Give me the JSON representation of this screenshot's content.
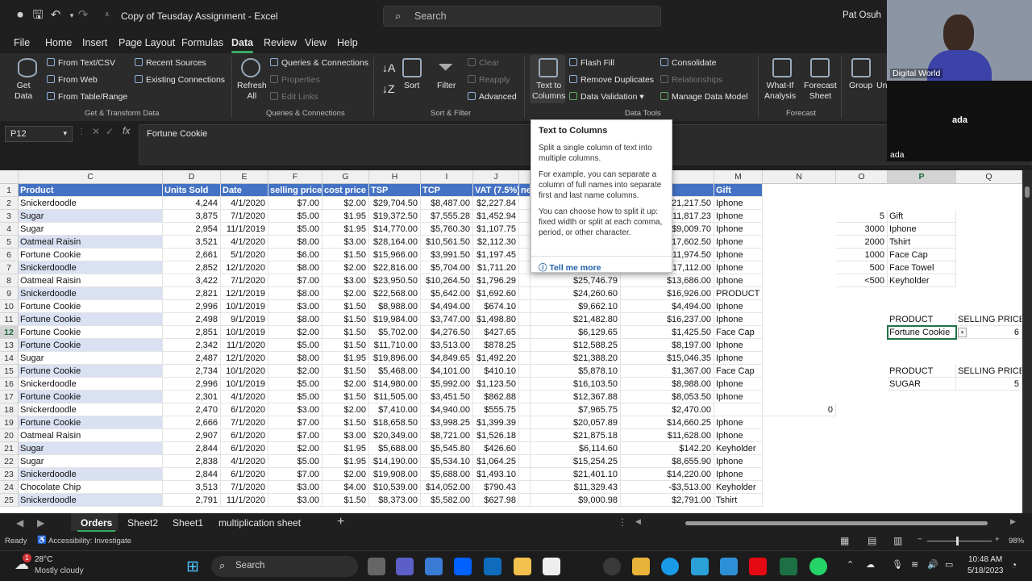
{
  "titlebar": {
    "doc_title": "Copy of Teusday Assignment  -  Excel",
    "search_placeholder": "Search",
    "user_name": "Pat Osuh"
  },
  "menu": {
    "tabs": [
      "File",
      "Home",
      "Insert",
      "Page Layout",
      "Formulas",
      "Data",
      "Review",
      "View",
      "Help"
    ],
    "active": "Data"
  },
  "ribbon": {
    "get_data": "Get\nData",
    "from_text_csv": "From Text/CSV",
    "from_web": "From Web",
    "from_table_range": "From Table/Range",
    "recent_sources": "Recent Sources",
    "existing_connections": "Existing Connections",
    "group_get_transform": "Get & Transform Data",
    "refresh_all": "Refresh\nAll",
    "queries_connections": "Queries & Connections",
    "properties": "Properties",
    "edit_links": "Edit Links",
    "group_queries": "Queries & Connections",
    "sort": "Sort",
    "filter": "Filter",
    "clear": "Clear",
    "reapply": "Reapply",
    "advanced": "Advanced",
    "group_sort_filter": "Sort & Filter",
    "text_to_columns": "Text to\nColumns",
    "flash_fill": "Flash Fill",
    "remove_duplicates": "Remove Duplicates",
    "data_validation": "Data Validation",
    "consolidate": "Consolidate",
    "relationships": "Relationships",
    "manage_data_model": "Manage Data Model",
    "group_data_tools": "Data Tools",
    "what_if": "What-If\nAnalysis",
    "forecast_sheet": "Forecast\nSheet",
    "group_forecast": "Forecast",
    "group_btn": "Group",
    "ungroup_btn": "Un"
  },
  "formula_bar": {
    "name_box": "P12",
    "fx": "fx",
    "value": "Fortune Cookie"
  },
  "columns": [
    "C",
    "D",
    "E",
    "F",
    "G",
    "H",
    "I",
    "J",
    "",
    "",
    "L",
    "M",
    "N",
    "O",
    "P",
    "Q"
  ],
  "table_headers": [
    "Product",
    "Units Sold",
    "Date",
    "selling price",
    "cost price",
    "TSP",
    "TCP",
    "VAT (7.5%)",
    "ne",
    "",
    "",
    "Gift"
  ],
  "rows": [
    [
      "Snickerdoodle",
      "4,244",
      "4/1/2020",
      "$7.00",
      "$2.00",
      "$29,704.50",
      "$8,487.00",
      "$2,227.84",
      "",
      "",
      "$21,217.50",
      "Iphone"
    ],
    [
      "Sugar",
      "3,875",
      "7/1/2020",
      "$5.00",
      "$1.95",
      "$19,372.50",
      "$7,555.28",
      "$1,452.94",
      "",
      "",
      "$11,817.23",
      "Iphone"
    ],
    [
      "Sugar",
      "2,954",
      "11/1/2019",
      "$5.00",
      "$1.95",
      "$14,770.00",
      "$5,760.30",
      "$1,107.75",
      "",
      "",
      "$9,009.70",
      "Iphone"
    ],
    [
      "Oatmeal Raisin",
      "3,521",
      "4/1/2020",
      "$8.00",
      "$3.00",
      "$28,164.00",
      "$10,561.50",
      "$2,112.30",
      "",
      "",
      "$17,602.50",
      "Iphone"
    ],
    [
      "Fortune Cookie",
      "2,661",
      "5/1/2020",
      "$6.00",
      "$1.50",
      "$15,966.00",
      "$3,991.50",
      "$1,197.45",
      "",
      "",
      "$11,974.50",
      "Iphone"
    ],
    [
      "Snickerdoodle",
      "2,852",
      "12/1/2020",
      "$8.00",
      "$2.00",
      "$22,816.00",
      "$5,704.00",
      "$1,711.20",
      "",
      "",
      "$17,112.00",
      "Iphone"
    ],
    [
      "Oatmeal Raisin",
      "3,422",
      "7/1/2020",
      "$7.00",
      "$3.00",
      "$23,950.50",
      "$10,264.50",
      "$1,796.29",
      "",
      "$25,746.79",
      "$13,686.00",
      "Iphone"
    ],
    [
      "Snickerdoodle",
      "2,821",
      "12/1/2019",
      "$8.00",
      "$2.00",
      "$22,568.00",
      "$5,642.00",
      "$1,692.60",
      "",
      "$24,260.60",
      "$16,926.00",
      "PRODUCT"
    ],
    [
      "Fortune Cookie",
      "2,996",
      "10/1/2019",
      "$3.00",
      "$1.50",
      "$8,988.00",
      "$4,494.00",
      "$674.10",
      "",
      "$9,662.10",
      "$4,494.00",
      "Iphone"
    ],
    [
      "Fortune Cookie",
      "2,498",
      "9/1/2019",
      "$8.00",
      "$1.50",
      "$19,984.00",
      "$3,747.00",
      "$1,498.80",
      "",
      "$21,482.80",
      "$16,237.00",
      "Iphone"
    ],
    [
      "Fortune Cookie",
      "2,851",
      "10/1/2019",
      "$2.00",
      "$1.50",
      "$5,702.00",
      "$4,276.50",
      "$427.65",
      "",
      "$6,129.65",
      "$1,425.50",
      "Face Cap"
    ],
    [
      "Fortune Cookie",
      "2,342",
      "11/1/2020",
      "$5.00",
      "$1.50",
      "$11,710.00",
      "$3,513.00",
      "$878.25",
      "",
      "$12,588.25",
      "$8,197.00",
      "Iphone"
    ],
    [
      "Sugar",
      "2,487",
      "12/1/2020",
      "$8.00",
      "$1.95",
      "$19,896.00",
      "$4,849.65",
      "$1,492.20",
      "",
      "$21,388.20",
      "$15,046.35",
      "Iphone"
    ],
    [
      "Fortune Cookie",
      "2,734",
      "10/1/2020",
      "$2.00",
      "$1.50",
      "$5,468.00",
      "$4,101.00",
      "$410.10",
      "",
      "$5,878.10",
      "$1,367.00",
      "Face Cap"
    ],
    [
      "Snickerdoodle",
      "2,996",
      "10/1/2019",
      "$5.00",
      "$2.00",
      "$14,980.00",
      "$5,992.00",
      "$1,123.50",
      "",
      "$16,103.50",
      "$8,988.00",
      "Iphone"
    ],
    [
      "Fortune Cookie",
      "2,301",
      "4/1/2020",
      "$5.00",
      "$1.50",
      "$11,505.00",
      "$3,451.50",
      "$862.88",
      "",
      "$12,367.88",
      "$8,053.50",
      "Iphone"
    ],
    [
      "Snickerdoodle",
      "2,470",
      "6/1/2020",
      "$3.00",
      "$2.00",
      "$7,410.00",
      "$4,940.00",
      "$555.75",
      "",
      "$7,965.75",
      "$2,470.00",
      ""
    ],
    [
      "Fortune Cookie",
      "2,666",
      "7/1/2020",
      "$7.00",
      "$1.50",
      "$18,658.50",
      "$3,998.25",
      "$1,399.39",
      "",
      "$20,057.89",
      "$14,660.25",
      "Iphone"
    ],
    [
      "Oatmeal Raisin",
      "2,907",
      "6/1/2020",
      "$7.00",
      "$3.00",
      "$20,349.00",
      "$8,721.00",
      "$1,526.18",
      "",
      "$21,875.18",
      "$11,628.00",
      "Iphone"
    ],
    [
      "Sugar",
      "2,844",
      "6/1/2020",
      "$2.00",
      "$1.95",
      "$5,688.00",
      "$5,545.80",
      "$426.60",
      "",
      "$6,114.60",
      "$142.20",
      "Keyholder"
    ],
    [
      "Sugar",
      "2,838",
      "4/1/2020",
      "$5.00",
      "$1.95",
      "$14,190.00",
      "$5,534.10",
      "$1,064.25",
      "",
      "$15,254.25",
      "$8,655.90",
      "Iphone"
    ],
    [
      "Snickerdoodle",
      "2,844",
      "6/1/2020",
      "$7.00",
      "$2.00",
      "$19,908.00",
      "$5,688.00",
      "$1,493.10",
      "",
      "$21,401.10",
      "$14,220.00",
      "Iphone"
    ],
    [
      "Chocolate Chip",
      "3,513",
      "7/1/2020",
      "$3.00",
      "$4.00",
      "$10,539.00",
      "$14,052.00",
      "$790.43",
      "",
      "$11,329.43",
      "-$3,513.00",
      "Keyholder"
    ],
    [
      "Snickerdoodle",
      "2,791",
      "11/1/2020",
      "$3.00",
      "$1.50",
      "$8,373.00",
      "$5,582.00",
      "$627.98",
      "",
      "$9,000.98",
      "$2,791.00",
      "Tshirt"
    ]
  ],
  "n18_value": "0",
  "gift_table": [
    [
      "5",
      "Gift"
    ],
    [
      "3000",
      "Iphone"
    ],
    [
      "2000",
      "Tshirt"
    ],
    [
      "1000",
      "Face Cap"
    ],
    [
      "500",
      "Face Towel"
    ],
    [
      "<500",
      "Keyholder"
    ]
  ],
  "lookup1": {
    "label": "PRODUCT",
    "price_label": "SELLING PRICE",
    "product": "Fortune Cookie",
    "price": "6"
  },
  "lookup2": {
    "label": "PRODUCT",
    "price_label": "SELLING PRICE",
    "product": "SUGAR",
    "price": "5"
  },
  "tooltip": {
    "title": "Text to Columns",
    "p1": "Split a single column of text into multiple columns.",
    "p2": "For example, you can separate a column of full names into separate first and last name columns.",
    "p3": "You can choose how to split it up: fixed width or split at each comma, period, or other character.",
    "more": "Tell me more"
  },
  "sheets": [
    "Orders",
    "Sheet2",
    "Sheet1",
    "multiplication sheet"
  ],
  "active_sheet": "Orders",
  "status": {
    "ready": "Ready",
    "accessibility": "Accessibility: Investigate",
    "zoom": "98%"
  },
  "taskbar": {
    "weather_temp": "28°C",
    "weather_desc": "Mostly cloudy",
    "search": "Search",
    "time": "10:48 AM",
    "date": "5/18/2023",
    "badge": "1"
  },
  "webcam": {
    "label1": "Digital World",
    "label2": "ada",
    "label3": "ada"
  },
  "colors": {
    "header_blue": "#4472c4",
    "band_blue": "#d9e1f2",
    "excel_green": "#217346"
  }
}
